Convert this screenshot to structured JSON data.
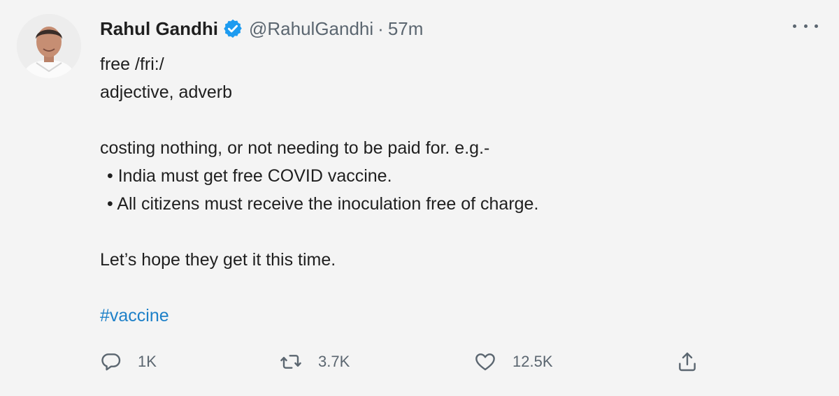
{
  "tweet": {
    "author": {
      "name": "Rahul Gandhi",
      "handle": "@RahulGandhi",
      "separator": "·",
      "time": "57m",
      "verified": true
    },
    "lines": {
      "l1": "free /fri:/",
      "l2": "adjective, adverb",
      "l3": "costing nothing, or not needing to be paid for. e.g.-",
      "l4": "• India must get free COVID vaccine.",
      "l5": "• All citizens must receive the inoculation free of charge.",
      "l6": "Let’s hope they get it this time.",
      "hashtag": "#vaccine"
    },
    "stats": {
      "replies": "1K",
      "retweets": "3.7K",
      "likes": "12.5K"
    }
  },
  "icons": {
    "more": "more-horizontal-icon",
    "verified": "verified-badge-icon",
    "reply": "reply-bubble-icon",
    "retweet": "retweet-icon",
    "like": "heart-icon",
    "share": "share-upload-icon"
  },
  "colors": {
    "background": "#f4f4f4",
    "text": "#1f1f1f",
    "secondary": "#5b6670",
    "link": "#1d80c8",
    "verified": "#1d9bf0"
  }
}
